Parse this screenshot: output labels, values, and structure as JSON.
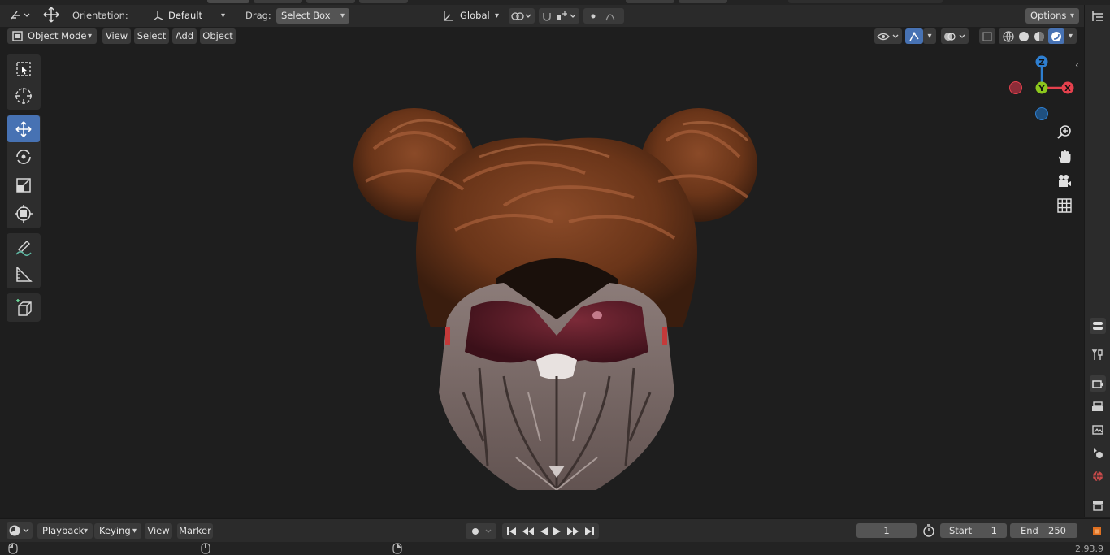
{
  "header": {
    "orientation_label": "Orientation:",
    "orientation_value": "Default",
    "drag_label": "Drag:",
    "drag_value": "Select Box",
    "transform_orientation": "Global",
    "options_label": "Options"
  },
  "viewport_header": {
    "mode": "Object Mode",
    "menu": [
      "View",
      "Select",
      "Add",
      "Object"
    ]
  },
  "gizmo": {
    "z": "Z",
    "y": "Y",
    "x": "X"
  },
  "timeline": {
    "menu": [
      "Playback",
      "Keying",
      "View",
      "Marker"
    ],
    "current_frame": "1",
    "start_label": "Start",
    "start_value": "1",
    "end_label": "End",
    "end_value": "250"
  },
  "status": {
    "version": "2.93.9"
  },
  "colors": {
    "accent": "#4772b3",
    "axis_x": "#e5414d",
    "axis_y": "#8cc71d",
    "axis_z": "#2e7fd1"
  },
  "icons": {
    "tools": [
      "select-box-icon",
      "cursor-icon",
      "move-icon",
      "rotate-icon",
      "scale-icon",
      "transform-icon",
      "annotate-icon",
      "measure-icon",
      "add-cube-icon"
    ],
    "navigation": [
      "zoom-icon",
      "pan-hand-icon",
      "camera-icon",
      "grid-icon"
    ],
    "properties": [
      "tool-icon",
      "render-icon",
      "output-icon",
      "view-layer-icon",
      "scene-icon",
      "world-icon",
      "collection-icon",
      "object-icon"
    ]
  }
}
